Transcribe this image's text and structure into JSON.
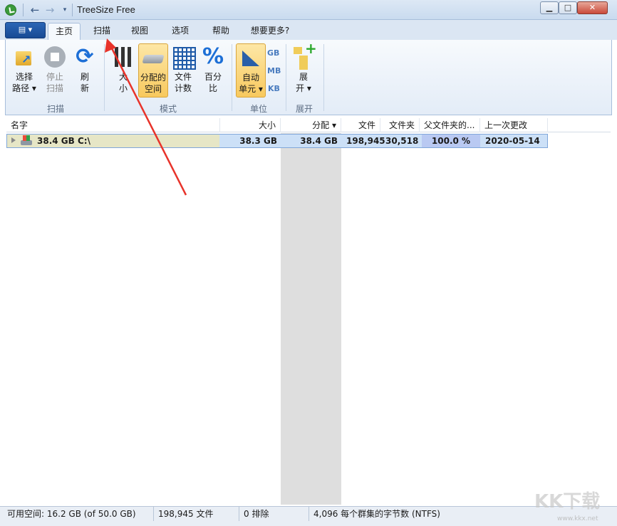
{
  "window": {
    "title": "TreeSize Free",
    "controls": {
      "minimize": "▁",
      "maximize": "□",
      "close": "✕"
    }
  },
  "quick_access": {
    "back": "←",
    "forward": "→",
    "dropdown": "▾"
  },
  "file_tab": {
    "label": "▤ ▾"
  },
  "tabs": [
    {
      "label": "主页",
      "active": true
    },
    {
      "label": "扫描"
    },
    {
      "label": "视图"
    },
    {
      "label": "选项"
    },
    {
      "label": "帮助"
    },
    {
      "label": "想要更多?"
    }
  ],
  "ribbon": {
    "scan_group": {
      "label": "扫描",
      "buttons": [
        {
          "label1": "选择",
          "label2": "路径 ▾",
          "icon": "folder-icon"
        },
        {
          "label1": "停止",
          "label2": "扫描",
          "icon": "stop-icon",
          "disabled": true
        },
        {
          "label1": "刷",
          "label2": "新",
          "icon": "refresh-icon",
          "glyph": "⟳"
        }
      ]
    },
    "mode_group": {
      "label": "模式",
      "buttons": [
        {
          "label1": "大",
          "label2": "小",
          "icon": "bars-icon"
        },
        {
          "label1": "分配的",
          "label2": "空间",
          "icon": "disk-icon",
          "selected": true
        },
        {
          "label1": "文件",
          "label2": "计数",
          "icon": "grid-icon"
        },
        {
          "label1": "百分",
          "label2": "比",
          "icon": "percent-icon",
          "glyph": "%"
        }
      ]
    },
    "unit_group": {
      "label": "单位",
      "auto": {
        "label1": "自动",
        "label2": "单元 ▾",
        "selected": true
      },
      "units": [
        "GB",
        "MB",
        "KB"
      ]
    },
    "expand_group": {
      "label": "展开",
      "button": {
        "label1": "展",
        "label2": "开 ▾"
      }
    }
  },
  "columns": [
    "名字",
    "大小",
    "分配 ▾",
    "文件",
    "文件夹",
    "父文件夹的...",
    "上一次更改"
  ],
  "rows": [
    {
      "name": "38.4 GB    C:\\",
      "size": "38.3 GB",
      "allocated": "38.4 GB",
      "files": "198,945",
      "folders": "30,518",
      "parent_pct": "100.0 %",
      "last_change": "2020-05-14"
    }
  ],
  "statusbar": {
    "free_space": "可用空间: 16.2 GB  (of 50.0 GB)",
    "files": "198,945 文件",
    "excluded": "0 排除",
    "cluster": "4,096 每个群集的字节数 (NTFS)"
  },
  "watermark": {
    "main": "KK下载",
    "sub": "www.kkx.net"
  },
  "colors": {
    "accent": "#1e5aa8",
    "selection": "#cce0f7",
    "arrow": "#e8332a"
  }
}
